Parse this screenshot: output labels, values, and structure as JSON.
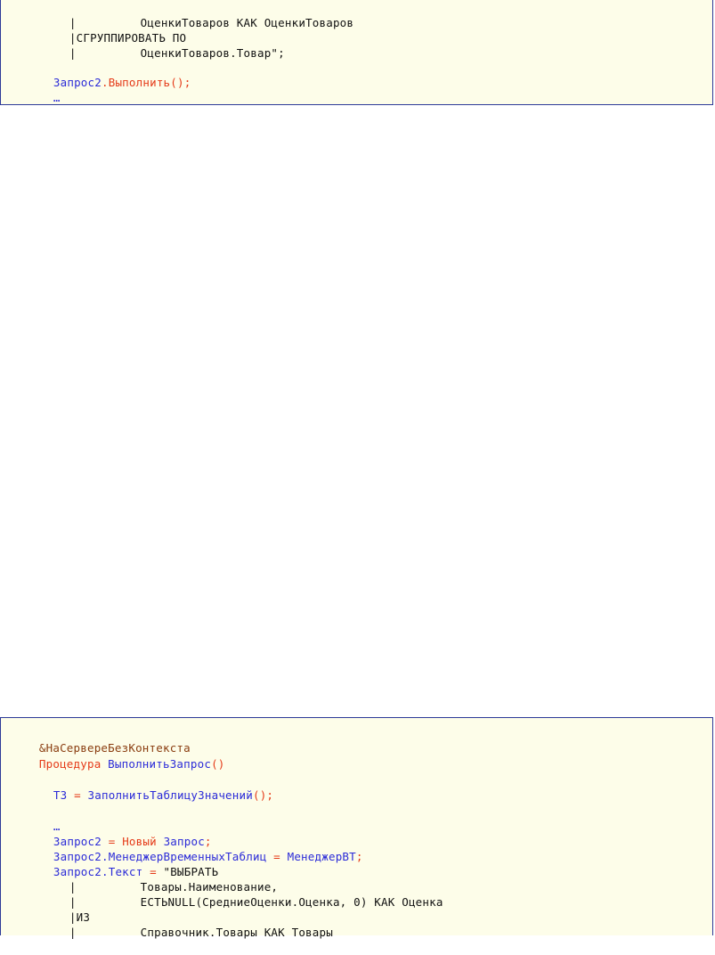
{
  "top_block": {
    "lines": [
      {
        "pipe": "|",
        "text": "ОценкиТоваров КАК ОценкиТоваров"
      },
      {
        "pipe": "|",
        "text": "СГРУППИРОВАТЬ ПО"
      },
      {
        "pipe": "|",
        "text": "ОценкиТоваров.Товар\";"
      }
    ],
    "call": {
      "obj": "Запрос2",
      "dot": ".",
      "method": "Выполнить",
      "tail": "();"
    },
    "ellipsis": "…"
  },
  "bottom_block": {
    "directive": "&НаСервереБезКонтекста",
    "proc_keyword": "Процедура",
    "proc_name": "ВыполнитьЗапрос",
    "proc_parens": "()",
    "line_tz": {
      "var": "ТЗ",
      "eq": " = ",
      "func": "ЗаполнитьТаблицуЗначений",
      "tail": "();"
    },
    "ellipsis": "…",
    "line_new": {
      "var": "Запрос2",
      "eq": " = ",
      "kw": "Новый",
      "type": "Запрос",
      "tail": ";"
    },
    "line_manager": {
      "obj": "Запрос2",
      "prop": ".МенеджерВременныхТаблиц",
      "eq": " = ",
      "val": "МенеджерВТ",
      "tail": ";"
    },
    "line_text": {
      "obj": "Запрос2",
      "prop": ".Текст",
      "eq": " = ",
      "str": "\"ВЫБРАТЬ"
    },
    "query_lines": [
      {
        "pipe": "|",
        "text": "Товары.Наименование,"
      },
      {
        "pipe": "|",
        "text": "ЕСТЬNULL(СредниеОценки.Оценка, 0) КАК Оценка"
      },
      {
        "pipe": "|",
        "text": "ИЗ"
      },
      {
        "pipe": "|",
        "text": "Справочник.Товары КАК Товары"
      }
    ]
  }
}
